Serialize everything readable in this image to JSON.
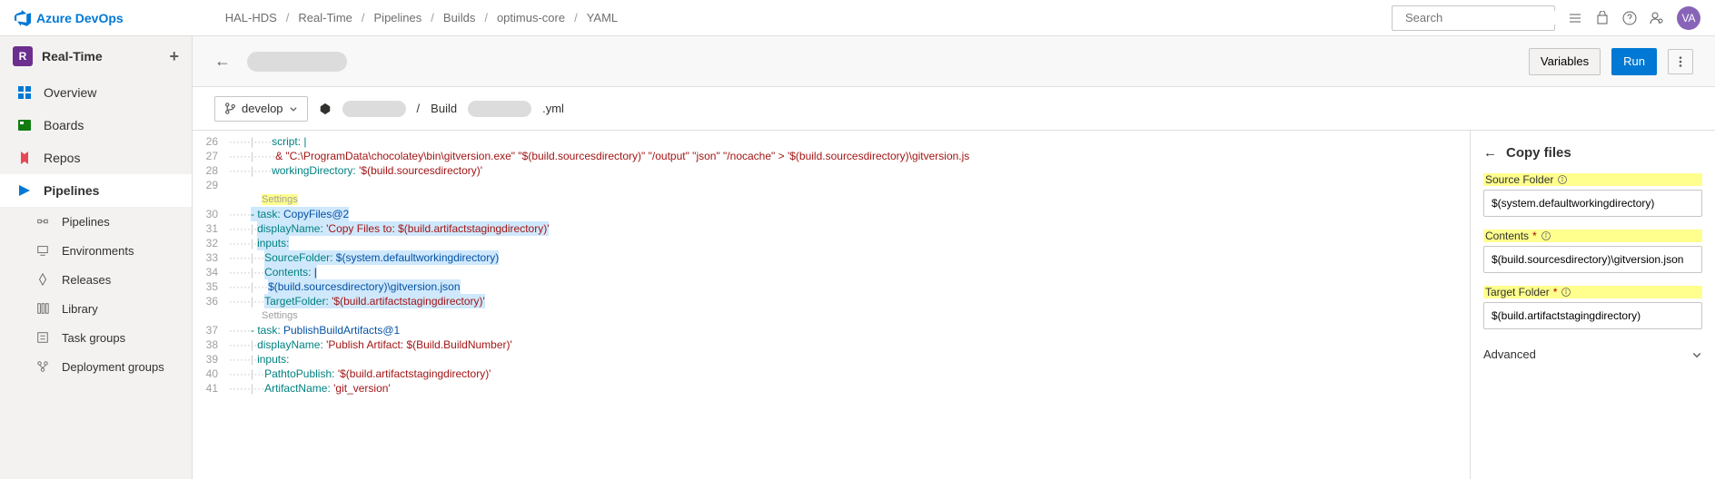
{
  "brand": "Azure DevOps",
  "breadcrumbs": [
    "HAL-HDS",
    "Real-Time",
    "Pipelines",
    "Builds",
    "optimus-core",
    "YAML"
  ],
  "search": {
    "placeholder": "Search"
  },
  "avatar": "VA",
  "project": {
    "initial": "R",
    "name": "Real-Time"
  },
  "nav": {
    "overview": "Overview",
    "boards": "Boards",
    "repos": "Repos",
    "pipelines": "Pipelines",
    "pipelines_sub": "Pipelines",
    "env": "Environments",
    "releases": "Releases",
    "library": "Library",
    "taskgroups": "Task groups",
    "deployment": "Deployment groups"
  },
  "toolbar": {
    "variables": "Variables",
    "run": "Run"
  },
  "branch": "develop",
  "filepath": {
    "sep": "/",
    "prefix": "Build",
    "suffix": ".yml"
  },
  "code": {
    "l26": {
      "n": "26",
      "t": "script: |"
    },
    "l27": {
      "n": "27",
      "t": "& \"C:\\ProgramData\\chocolatey\\bin\\gitversion.exe\" \"$(build.sourcesdirectory)\" \"/output\" \"json\" \"/nocache\" > '$(build.sourcesdirectory)\\gitversion.js"
    },
    "l28": {
      "n": "28",
      "k": "workingDirectory:",
      "v": " '$(build.sourcesdirectory)'"
    },
    "l29": {
      "n": "29"
    },
    "settings1": "Settings",
    "l30": {
      "n": "30",
      "k": "- task:",
      "v": " CopyFiles@2"
    },
    "l31": {
      "n": "31",
      "k": "displayName:",
      "v": " 'Copy Files to: $(build.artifactstagingdirectory)'"
    },
    "l32": {
      "n": "32",
      "k": "inputs:"
    },
    "l33": {
      "n": "33",
      "k": "SourceFolder:",
      "v": " $(system.defaultworkingdirectory)"
    },
    "l34": {
      "n": "34",
      "k": "Contents:",
      "v": " |"
    },
    "l35": {
      "n": "35",
      "v": "$(build.sourcesdirectory)\\gitversion.json"
    },
    "l36": {
      "n": "36",
      "k": "TargetFolder:",
      "v": " '$(build.artifactstagingdirectory)'"
    },
    "settings2": "Settings",
    "l37": {
      "n": "37",
      "k": "- task:",
      "v": " PublishBuildArtifacts@1"
    },
    "l38": {
      "n": "38",
      "k": "displayName:",
      "v": " 'Publish Artifact: $(Build.BuildNumber)'"
    },
    "l39": {
      "n": "39",
      "k": "inputs:"
    },
    "l40": {
      "n": "40",
      "k": "PathtoPublish:",
      "v": " '$(build.artifactstagingdirectory)'"
    },
    "l41": {
      "n": "41",
      "k": "ArtifactName:",
      "v": " 'git_version'"
    }
  },
  "panel": {
    "title": "Copy files",
    "source": {
      "label": "Source Folder",
      "value": "$(system.defaultworkingdirectory)"
    },
    "contents": {
      "label": "Contents",
      "value": "$(build.sourcesdirectory)\\gitversion.json"
    },
    "target": {
      "label": "Target Folder",
      "value": "$(build.artifactstagingdirectory)"
    },
    "advanced": "Advanced"
  }
}
